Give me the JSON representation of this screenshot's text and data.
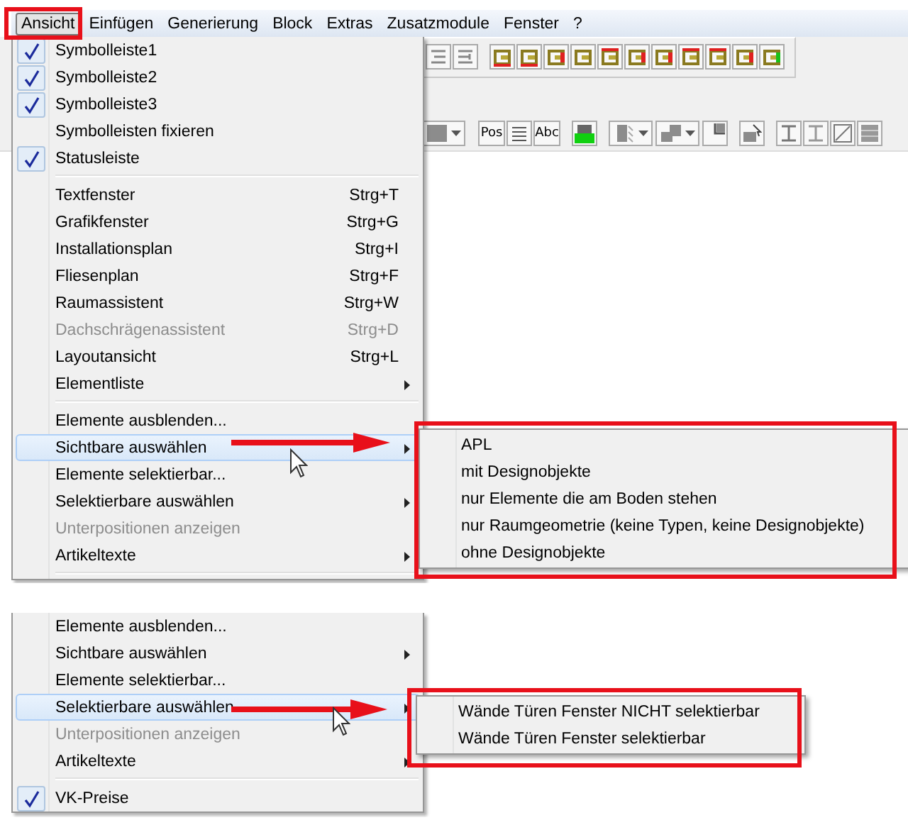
{
  "menu_bar": [
    {
      "label": "Ansicht",
      "selected": true
    },
    {
      "label": "Einfügen",
      "selected": false
    },
    {
      "label": "Generierung",
      "selected": false
    },
    {
      "label": "Block",
      "selected": false
    },
    {
      "label": "Extras",
      "selected": false
    },
    {
      "label": "Zusatzmodule",
      "selected": false
    },
    {
      "label": "Fenster",
      "selected": false
    },
    {
      "label": "?",
      "selected": false
    }
  ],
  "toolbar": {
    "text_buttons": [
      "Pos",
      "Abc"
    ]
  },
  "panels": [
    {
      "menu": [
        {
          "kind": "item",
          "label": "Symbolleiste1",
          "checked": true,
          "disabled": false,
          "selected": false,
          "submenu": false
        },
        {
          "kind": "item",
          "label": "Symbolleiste2",
          "checked": true,
          "disabled": false,
          "selected": false,
          "submenu": false
        },
        {
          "kind": "item",
          "label": "Symbolleiste3",
          "checked": true,
          "disabled": false,
          "selected": false,
          "submenu": false
        },
        {
          "kind": "item",
          "label": "Symbolleisten fixieren",
          "checked": false,
          "disabled": false,
          "selected": false,
          "submenu": false
        },
        {
          "kind": "item",
          "label": "Statusleiste",
          "checked": true,
          "disabled": false,
          "selected": false,
          "submenu": false
        },
        {
          "kind": "separator"
        },
        {
          "kind": "item",
          "label": "Textfenster",
          "shortcut": "Strg+T",
          "checked": false,
          "disabled": false,
          "selected": false,
          "submenu": false
        },
        {
          "kind": "item",
          "label": "Grafikfenster",
          "shortcut": "Strg+G",
          "checked": false,
          "disabled": false,
          "selected": false,
          "submenu": false
        },
        {
          "kind": "item",
          "label": "Installationsplan",
          "shortcut": "Strg+I",
          "checked": false,
          "disabled": false,
          "selected": false,
          "submenu": false
        },
        {
          "kind": "item",
          "label": "Fliesenplan",
          "shortcut": "Strg+F",
          "checked": false,
          "disabled": false,
          "selected": false,
          "submenu": false
        },
        {
          "kind": "item",
          "label": "Raumassistent",
          "shortcut": "Strg+W",
          "checked": false,
          "disabled": false,
          "selected": false,
          "submenu": false
        },
        {
          "kind": "item",
          "label": "Dachschrägenassistent",
          "shortcut": "Strg+D",
          "checked": false,
          "disabled": true,
          "selected": false,
          "submenu": false
        },
        {
          "kind": "item",
          "label": "Layoutansicht",
          "shortcut": "Strg+L",
          "checked": false,
          "disabled": false,
          "selected": false,
          "submenu": false
        },
        {
          "kind": "item",
          "label": "Elementliste",
          "checked": false,
          "disabled": false,
          "selected": false,
          "submenu": true
        },
        {
          "kind": "separator"
        },
        {
          "kind": "item",
          "label": "Elemente ausblenden...",
          "checked": false,
          "disabled": false,
          "selected": false,
          "submenu": false
        },
        {
          "kind": "item",
          "label": "Sichtbare auswählen",
          "checked": false,
          "disabled": false,
          "selected": true,
          "submenu": true
        },
        {
          "kind": "item",
          "label": "Elemente selektierbar...",
          "checked": false,
          "disabled": false,
          "selected": false,
          "submenu": false
        },
        {
          "kind": "item",
          "label": "Selektierbare auswählen",
          "checked": false,
          "disabled": false,
          "selected": false,
          "submenu": true
        },
        {
          "kind": "item",
          "label": "Unterpositionen anzeigen",
          "checked": false,
          "disabled": true,
          "selected": false,
          "submenu": false
        },
        {
          "kind": "item",
          "label": "Artikeltexte",
          "checked": false,
          "disabled": false,
          "selected": false,
          "submenu": true
        },
        {
          "kind": "separator"
        }
      ],
      "submenu": [
        "APL",
        "mit Designobjekte",
        "nur Elemente die am Boden stehen",
        "nur Raumgeometrie (keine Typen, keine Designobjekte)",
        "ohne Designobjekte"
      ]
    },
    {
      "menu": [
        {
          "kind": "item",
          "label": "Elemente ausblenden...",
          "checked": false,
          "disabled": false,
          "selected": false,
          "submenu": false
        },
        {
          "kind": "item",
          "label": "Sichtbare auswählen",
          "checked": false,
          "disabled": false,
          "selected": false,
          "submenu": true
        },
        {
          "kind": "item",
          "label": "Elemente selektierbar...",
          "checked": false,
          "disabled": false,
          "selected": false,
          "submenu": false
        },
        {
          "kind": "item",
          "label": "Selektierbare auswählen",
          "checked": false,
          "disabled": false,
          "selected": true,
          "submenu": true
        },
        {
          "kind": "item",
          "label": "Unterpositionen anzeigen",
          "checked": false,
          "disabled": true,
          "selected": false,
          "submenu": false
        },
        {
          "kind": "item",
          "label": "Artikeltexte",
          "checked": false,
          "disabled": false,
          "selected": false,
          "submenu": true
        },
        {
          "kind": "separator"
        },
        {
          "kind": "item",
          "label": "VK-Preise",
          "checked": true,
          "disabled": false,
          "selected": false,
          "submenu": false
        }
      ],
      "submenu": [
        "Wände Türen Fenster NICHT selektierbar",
        "Wände Türen Fenster selektierbar"
      ]
    }
  ]
}
